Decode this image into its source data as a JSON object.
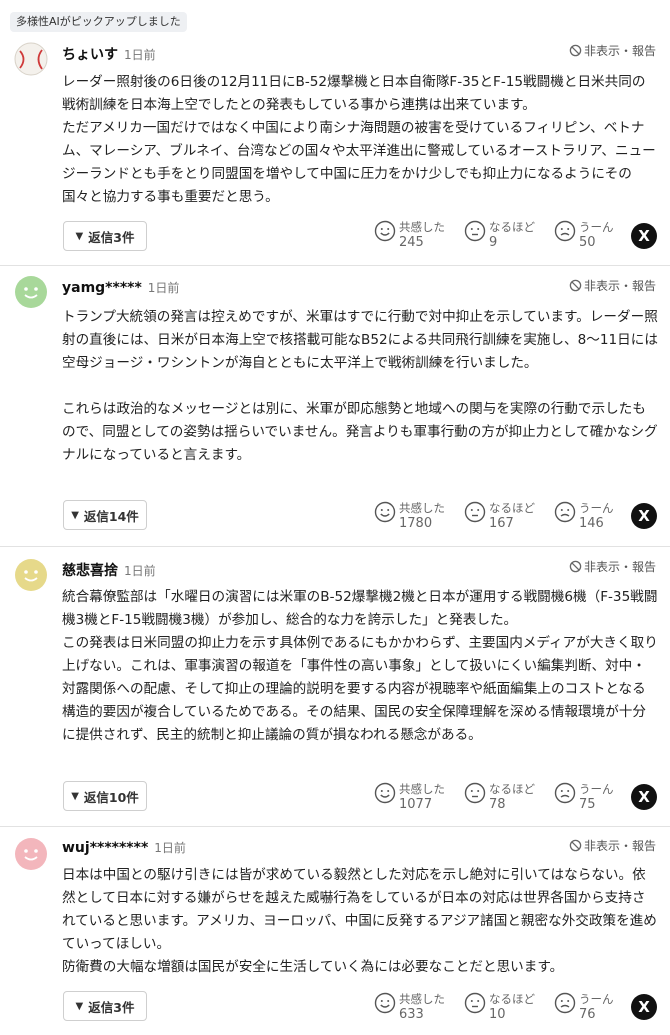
{
  "pickup_badge": "多様性AIがピックアップしました",
  "report_label": "非表示・報告",
  "reaction_labels": {
    "empathy": "共感した",
    "indeed": "なるほど",
    "hmm": "うーん"
  },
  "x_share_icon": "X",
  "comments": [
    {
      "user": "ちょいす",
      "avatar_icon": "baseball-avatar-icon",
      "time": "1日前",
      "text": "レーダー照射後の6日後の12月11日にB-52爆撃機と日本自衛隊F-35とF-15戦闘機と日米共同の戦術訓練を日本海上空でしたとの発表もしている事から連携は出来ています。\nただアメリカ一国だけではなく中国により南シナ海問題の被害を受けているフィリピン、ベトナム、マレーシア、ブルネイ、台湾などの国々や太平洋進出に警戒しているオーストラリア、ニュージーランドとも手をとり同盟国を増やして中国に圧力をかけ少しでも抑止力になるようにその国々と協力する事も重要だと思う。",
      "replies": "返信3件",
      "empathy": "245",
      "indeed": "9",
      "hmm": "50"
    },
    {
      "user": "yamg*****",
      "avatar_icon": "green-face-avatar-icon",
      "time": "1日前",
      "text": "トランプ大統領の発言は控えめですが、米軍はすでに行動で対中抑止を示しています。レーダー照射の直後には、日米が日本海上空で核搭載可能なB52による共同飛行訓練を実施し、8〜11日には空母ジョージ・ワシントンが海自とともに太平洋上で戦術訓練を行いました。\n\nこれらは政治的なメッセージとは別に、米軍が即応態勢と地域への関与を実際の行動で示したもので、同盟としての姿勢は揺らいでいません。発言よりも軍事行動の方が抑止力として確かなシグナルになっていると言えます。",
      "replies": "返信14件",
      "empathy": "1780",
      "indeed": "167",
      "hmm": "146"
    },
    {
      "user": "慈悲喜捨",
      "avatar_icon": "yellow-face-avatar-icon",
      "time": "1日前",
      "text": "統合幕僚監部は「水曜日の演習には米軍のB-52爆撃機2機と日本が運用する戦闘機6機（F-35戦闘機3機とF-15戦闘機3機）が参加し、総合的な力を誇示した」と発表した。\nこの発表は日米同盟の抑止力を示す具体例であるにもかかわらず、主要国内メディアが大きく取り上げない。これは、軍事演習の報道を「事件性の高い事象」として扱いにくい編集判断、対中・対露関係への配慮、そして抑止の理論的説明を要する内容が視聴率や紙面編集上のコストとなる構造的要因が複合しているためである。その結果、国民の安全保障理解を深める情報環境が十分に提供されず、民主的統制と抑止議論の質が損なわれる懸念がある。",
      "replies": "返信10件",
      "empathy": "1077",
      "indeed": "78",
      "hmm": "75"
    },
    {
      "user": "wuj********",
      "avatar_icon": "pink-face-avatar-icon",
      "time": "1日前",
      "text": "日本は中国との駆け引きには皆が求めている毅然とした対応を示し絶対に引いてはならない。依然として日本に対する嫌がらせを越えた威嚇行為をしているが日本の対応は世界各国から支持されていると思います。アメリカ、ヨーロッパ、中国に反発するアジア諸国と親密な外交政策を進めていってほしい。\n防衛費の大幅な増額は国民が安全に生活していく為には必要なことだと思います。",
      "replies": "返信3件",
      "empathy": "633",
      "indeed": "10",
      "hmm": "76"
    }
  ],
  "colors": {
    "divider": "#e2e2e2",
    "badge_bg": "#eef0f3",
    "green_avatar": "#a8d89a",
    "yellow_avatar": "#e6d98a",
    "pink_avatar": "#f3b6bc"
  }
}
